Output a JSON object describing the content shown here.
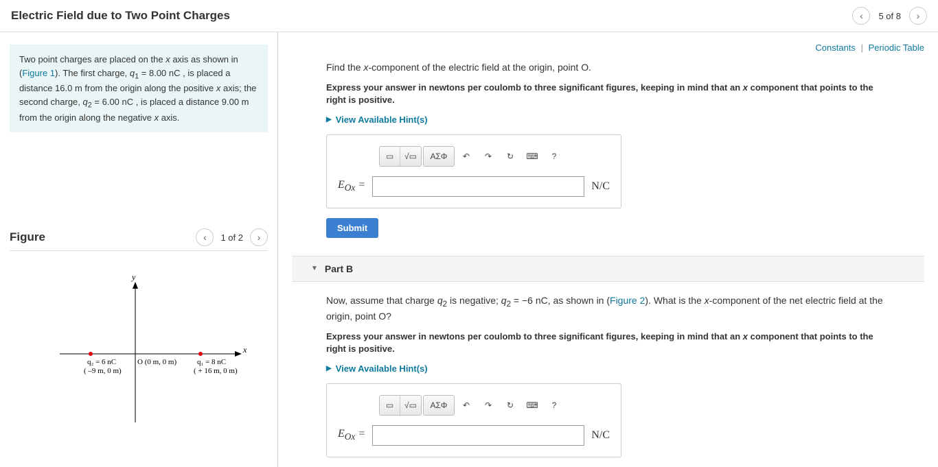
{
  "header": {
    "title": "Electric Field due to Two Point Charges",
    "page_pos": "5 of 8"
  },
  "top_links": {
    "constants": "Constants",
    "periodic": "Periodic Table"
  },
  "problem": {
    "html": "Two point charges are placed on the <em class='xf'>x</em> axis as shown in (<span class='flink'>Figure 1</span>). The first charge, <em class='xf'>q</em><sub>1</sub> = 8.00 nC , is placed a distance 16.0 m from the origin along the positive <em class='xf'>x</em> axis; the second charge, <em class='xf'>q</em><sub>2</sub> = 6.00 nC , is placed a distance 9.00 m from the origin along the negative <em class='xf'>x</em> axis."
  },
  "figure": {
    "title": "Figure",
    "page_pos": "1 of 2",
    "labels": {
      "y": "y",
      "x": "x",
      "q2_top": "q₂ = 6 nC",
      "q2_bot": "( –9 m, 0 m)",
      "origin": "O  (0 m, 0 m)",
      "q1_top": "q₁ = 8 nC",
      "q1_bot": "( + 16 m, 0 m)"
    }
  },
  "partA": {
    "question_html": "Find the <em class='xf'>x</em>-component of the electric field at the origin, point O.",
    "instruction_html": "Express your answer in newtons per coulomb to three significant figures, keeping in mind that an <em class='xf'>x</em> component that points to the right is positive.",
    "hints_label": "View Available Hint(s)",
    "answer_label_html": "E<sub>O<em>x</em></sub> =",
    "answer_unit": "N/C",
    "submit": "Submit"
  },
  "partB": {
    "title": "Part B",
    "question_html": "Now, assume that charge <em class='xf'>q</em><sub>2</sub> is negative; <em class='xf'>q</em><sub>2</sub> = −6 nC, as shown in (<span class='flink'>Figure 2</span>). What is the <em class='xf'>x</em>-component of the net electric field at the origin, point O?",
    "instruction_html": "Express your answer in newtons per coulomb to three significant figures, keeping in mind that an <em class='xf'>x</em> component that points to the right is positive.",
    "hints_label": "View Available Hint(s)",
    "answer_label_html": "E<sub>O<em>x</em></sub> =",
    "answer_unit": "N/C"
  },
  "toolbar": {
    "template": "▭",
    "sqrt": "√▭",
    "greek": "ΑΣΦ",
    "undo": "↶",
    "redo": "↷",
    "reset": "↻",
    "keyboard": "⌨",
    "help": "?"
  }
}
